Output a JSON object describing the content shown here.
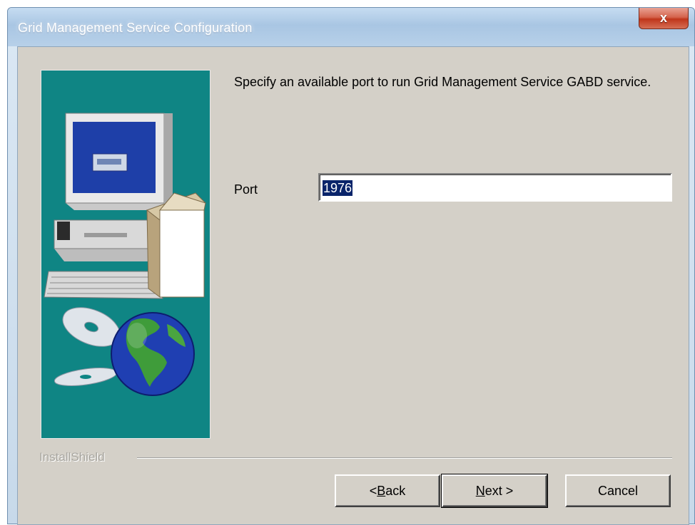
{
  "window": {
    "title": "Grid Management Service Configuration",
    "close_glyph": "x"
  },
  "body": {
    "instruction": "Specify an available port to run Grid Management Service GABD service.",
    "port_label": "Port",
    "port_value": "1976"
  },
  "footer": {
    "brand": "InstallShield"
  },
  "buttons": {
    "back_prefix": "< ",
    "back_mnemonic": "B",
    "back_rest": "ack",
    "next_mnemonic": "N",
    "next_rest": "ext >",
    "cancel_label": "Cancel"
  },
  "colors": {
    "art_background": "#0f8584",
    "selection": "#0a246a",
    "dialog_face": "#d4d0c8"
  },
  "icons": {
    "close": "close-icon",
    "artwork": "computer-box-cd-globe-illustration"
  }
}
